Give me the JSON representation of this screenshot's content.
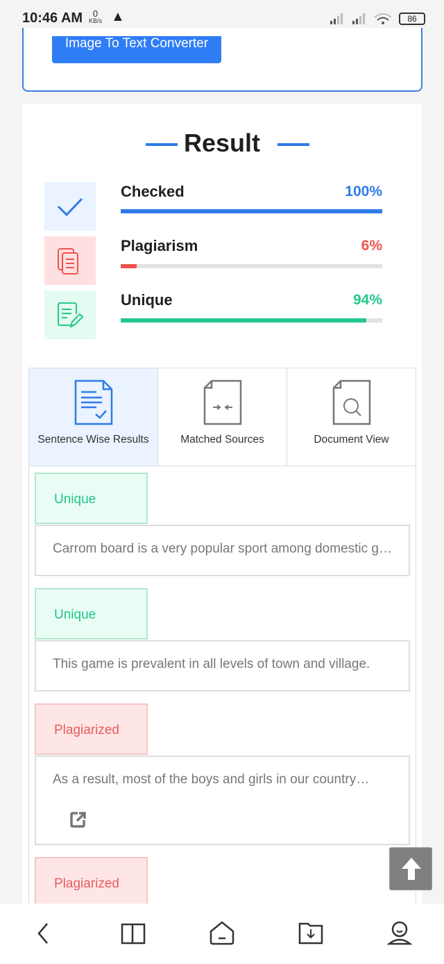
{
  "status_bar": {
    "time": "10:46 AM",
    "net_speed": "0",
    "net_unit": "KB/s",
    "battery": "86"
  },
  "top": {
    "converter_button": "Image To Text Converter"
  },
  "result": {
    "title": "Result",
    "stats": [
      {
        "label": "Checked",
        "percent_text": "100%",
        "value": 100,
        "color": "#2f7be8",
        "bg": "#eaf3ff",
        "icon": "check-icon"
      },
      {
        "label": "Plagiarism",
        "percent_text": "6%",
        "value": 6,
        "color": "#ef5350",
        "bg": "#ffe0e0",
        "icon": "copy-documents-icon"
      },
      {
        "label": "Unique",
        "percent_text": "94%",
        "value": 94,
        "color": "#22c98b",
        "bg": "#e3fbf1",
        "icon": "edit-document-icon"
      }
    ]
  },
  "tabs": [
    {
      "label": "Sentence Wise Results",
      "active": true
    },
    {
      "label": "Matched Sources"
    },
    {
      "label": "Document View"
    }
  ],
  "sentences": [
    {
      "status": "Unique",
      "text": "Carrom board is a very popular sport among domestic games in our country."
    },
    {
      "status": "Unique",
      "text": "This game is prevalent in all levels of town and village."
    },
    {
      "status": "Plagiarized",
      "text": "As a result, most of the boys and girls in our country…"
    },
    {
      "status": "Plagiarized"
    }
  ]
}
